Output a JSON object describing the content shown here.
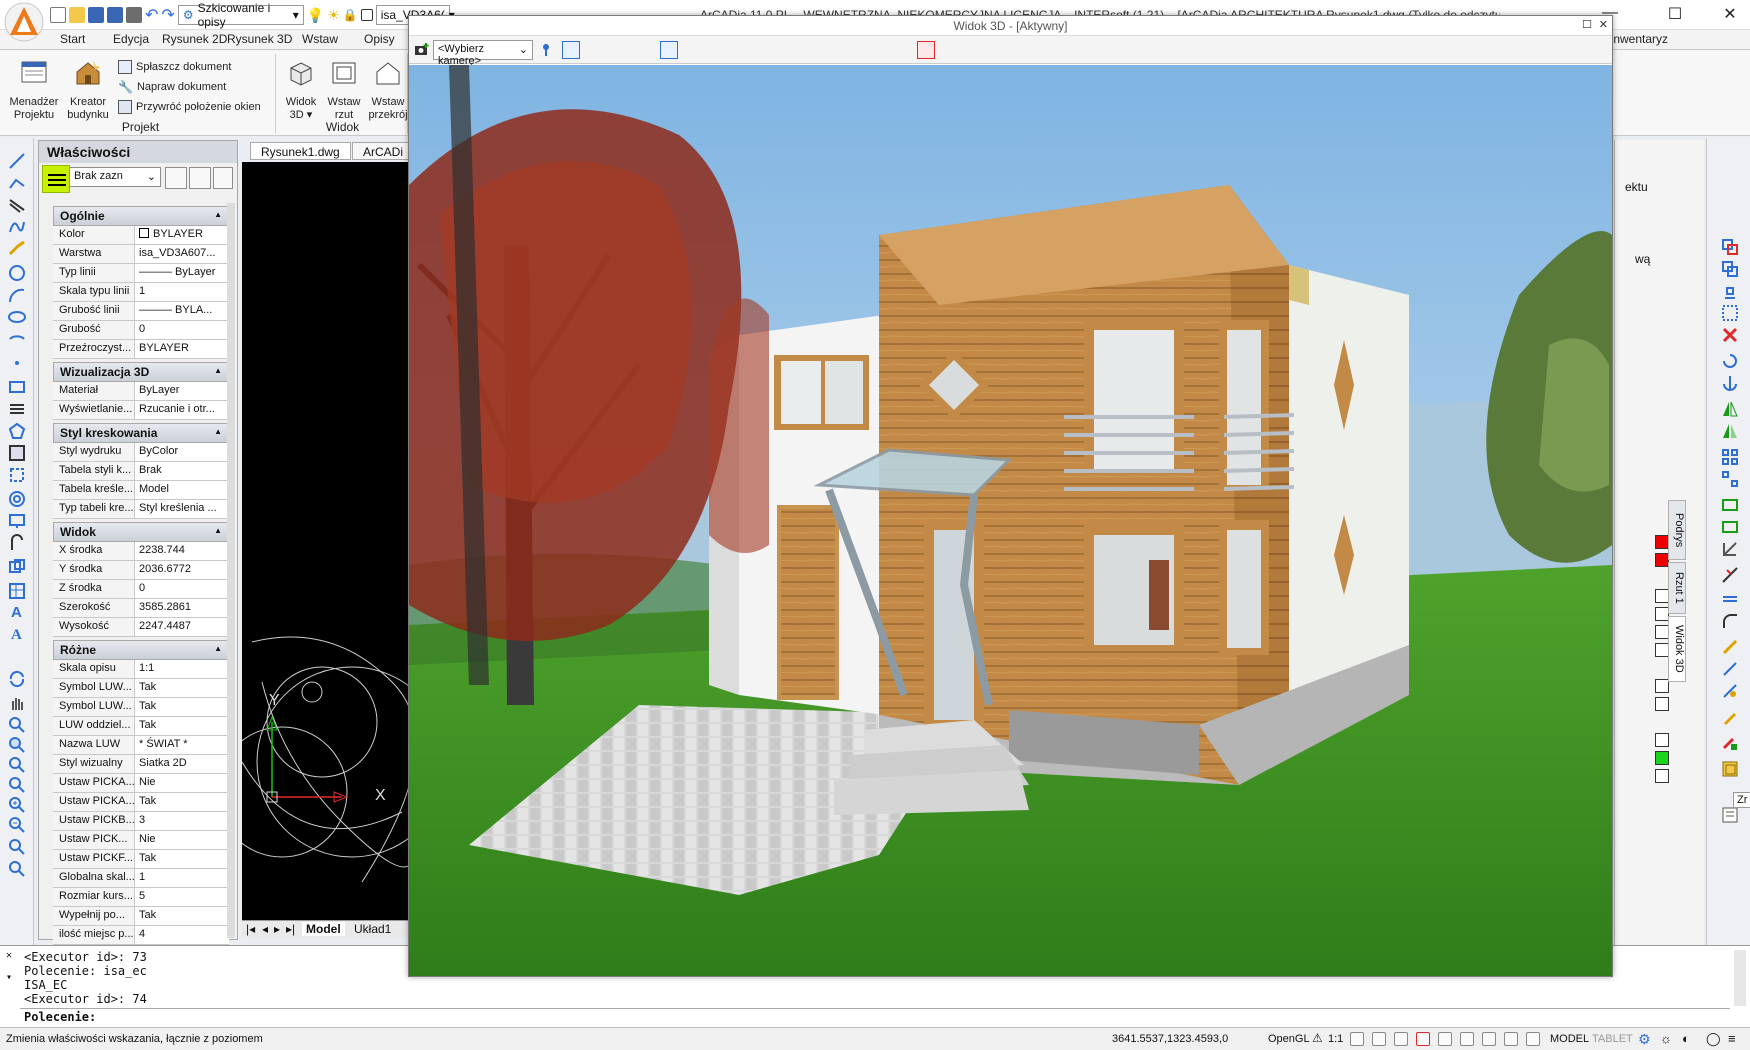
{
  "app": {
    "title": "ArCADia 11.0 PL – WEWNĘTRZNA, NIEKOMERCYJNA LICENCJA – INTERsoft (1.21) – [ArCADia ARCHITEKTURA Rysunek1.dwg (Tylko do odczytu)]",
    "workspace": "Szkicowanie i opisy",
    "layer_short": "isa_VD3A6(",
    "colors": {
      "accent": "#2e6fd6",
      "highlight": "#c6f000"
    }
  },
  "ribbon": {
    "tabs": [
      "Start",
      "Edycja",
      "Rysunek 2D",
      "Rysunek 3D",
      "Wstaw",
      "Opisy"
    ],
    "tab_right": "Inwentaryz",
    "groups": {
      "projekt": {
        "label": "Projekt",
        "big": [
          "Menadżer\nProjektu",
          "Kreator\nbudynku"
        ],
        "small": [
          "Spłaszcz dokument",
          "Napraw dokument",
          "Przywróć położenie okien"
        ]
      },
      "widok": {
        "label": "Widok",
        "big": [
          "Widok\n3D ▾",
          "Wstaw\nrzut",
          "Wstaw\nprzekrój"
        ]
      }
    }
  },
  "properties": {
    "title": "Właściwości",
    "selector": "Brak zazn",
    "sections": [
      {
        "name": "Ogólnie",
        "rows": [
          [
            "Kolor",
            "BYLAYER"
          ],
          [
            "Warstwa",
            "isa_VD3A607..."
          ],
          [
            "Typ linii",
            "——— ByLayer"
          ],
          [
            "Skala typu linii",
            "1"
          ],
          [
            "Grubość linii",
            "——— BYLA..."
          ],
          [
            "Grubość",
            "0"
          ],
          [
            "Przeźroczyst...",
            "BYLAYER"
          ]
        ]
      },
      {
        "name": "Wizualizacja 3D",
        "rows": [
          [
            "Materiał",
            "ByLayer"
          ],
          [
            "Wyświetlanie...",
            "Rzucanie i otr..."
          ]
        ]
      },
      {
        "name": "Styl kreskowania",
        "rows": [
          [
            "Styl wydruku",
            "ByColor"
          ],
          [
            "Tabela styli k...",
            "Brak"
          ],
          [
            "Tabela kreśle...",
            "Model"
          ],
          [
            "Typ tabeli kre...",
            "Styl kreślenia ..."
          ]
        ]
      },
      {
        "name": "Widok",
        "rows": [
          [
            "X środka",
            "2238.744"
          ],
          [
            "Y środka",
            "2036.6772"
          ],
          [
            "Z środka",
            "0"
          ],
          [
            "Szerokość",
            "3585.2861"
          ],
          [
            "Wysokość",
            "2247.4487"
          ]
        ]
      },
      {
        "name": "Różne",
        "rows": [
          [
            "Skala opisu",
            "1:1"
          ],
          [
            "Symbol LUW...",
            "Tak"
          ],
          [
            "Symbol LUW...",
            "Tak"
          ],
          [
            "LUW oddziel...",
            "Tak"
          ],
          [
            "Nazwa LUW",
            "* ŚWIAT *"
          ],
          [
            "Styl wizualny",
            "Siatka 2D"
          ],
          [
            "Ustaw PICKA...",
            "Nie"
          ],
          [
            "Ustaw PICKA...",
            "Tak"
          ],
          [
            "Ustaw PICKB...",
            "3"
          ],
          [
            "Ustaw PICK...",
            "Nie"
          ],
          [
            "Ustaw PICKF...",
            "Tak"
          ],
          [
            "Globalna skal...",
            "1"
          ],
          [
            "Rozmiar kurs...",
            "5"
          ],
          [
            "Wypełnij po...",
            "Tak"
          ],
          [
            "ilość miejsc p...",
            "4"
          ]
        ]
      }
    ]
  },
  "drawing": {
    "tabs": [
      "Rysunek1.dwg",
      "ArCADi"
    ],
    "layout_tabs": [
      "Model",
      "Układ1"
    ],
    "axis_y": "Y",
    "axis_x": "X"
  },
  "view3d": {
    "title": "Widok 3D - [Aktywny]",
    "camera_select": "<Wybierz kamerę>"
  },
  "right_panel": {
    "text1": "ektu",
    "text2": "wą",
    "vtabs": [
      "Podrys",
      "Rzut 1",
      "Widok 3D"
    ],
    "tooltip": "Zr"
  },
  "command": {
    "lines": [
      "<Executor id>: 73",
      "Polecenie: isa_ec",
      "ISA_EC",
      "<Executor id>: 74"
    ],
    "prompt": "Polecenie:"
  },
  "status": {
    "hint": "Zmienia właściwości wskazania, łącznie z poziomem",
    "coords": "3641.5537,1323.4593,0",
    "renderer": "OpenGL",
    "scale": "1:1",
    "mode": "MODEL",
    "tablet": "TABLET"
  }
}
